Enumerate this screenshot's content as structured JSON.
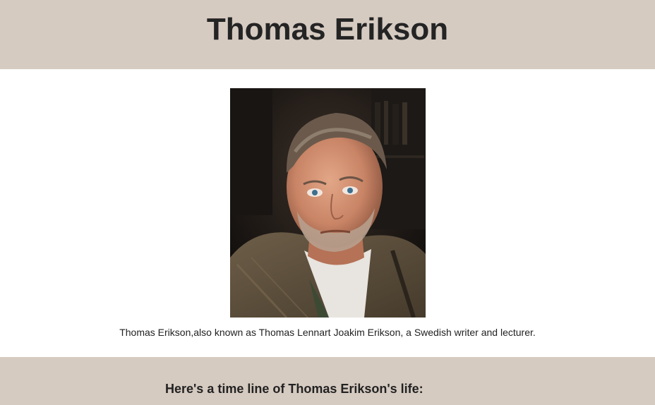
{
  "header": {
    "title": "Thomas Erikson",
    "background_color": "#d6cbc1"
  },
  "portrait": {
    "alt": "Thomas Erikson"
  },
  "caption": {
    "text": "Thomas Erikson,also known as Thomas Lennart Joakim Erikson, a Swedish writer and lecturer."
  },
  "timeline": {
    "heading": "Here's a time line of Thomas Erikson's life:",
    "background_color": "#d6cbc1"
  }
}
